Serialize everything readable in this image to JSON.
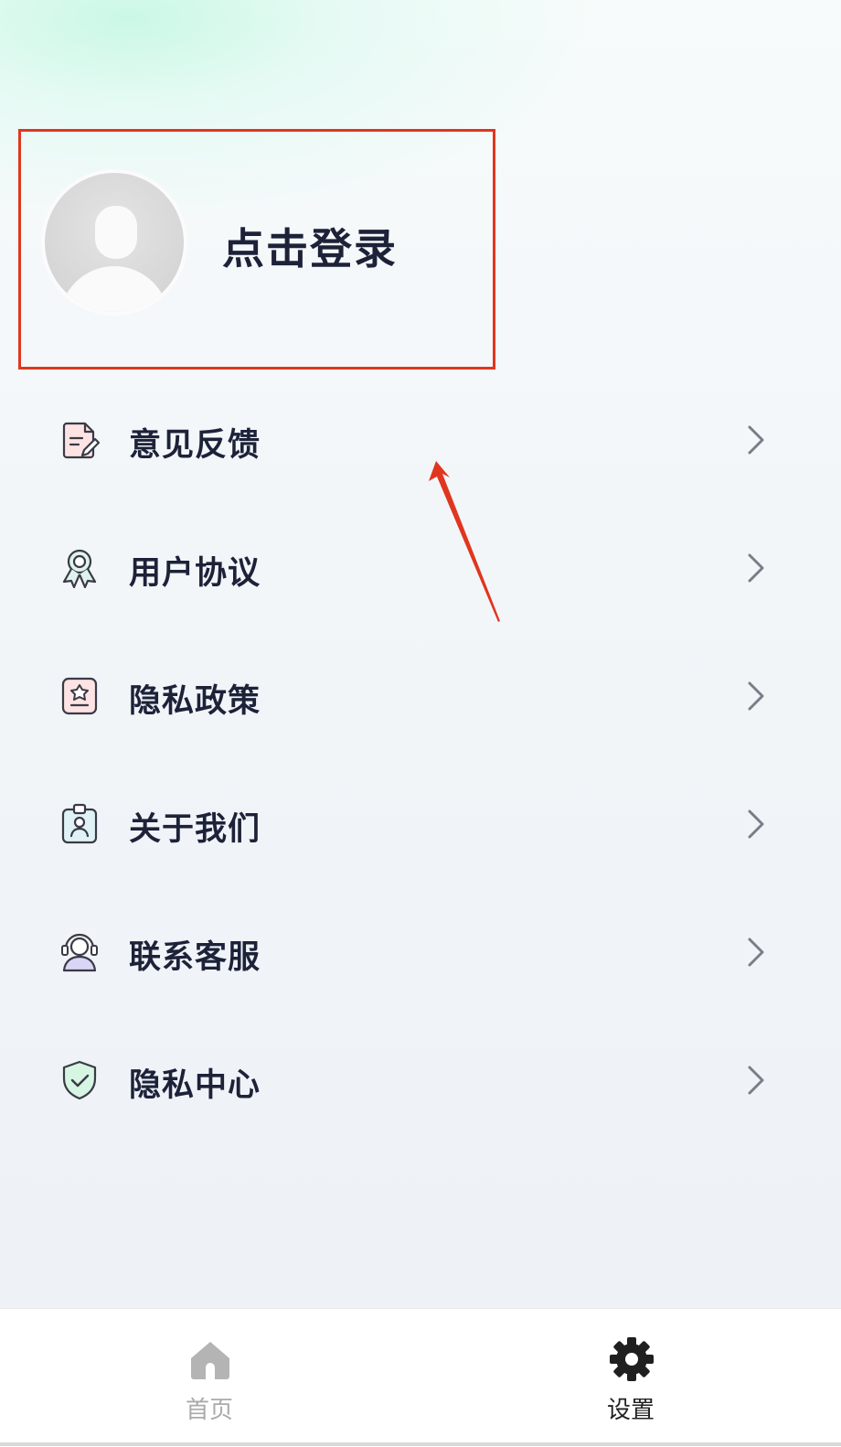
{
  "profile": {
    "login_label": "点击登录",
    "avatar_icon": "user-avatar-placeholder"
  },
  "menu": [
    {
      "label": "意见反馈",
      "icon": "feedback-icon"
    },
    {
      "label": "用户协议",
      "icon": "award-icon"
    },
    {
      "label": "隐私政策",
      "icon": "policy-icon"
    },
    {
      "label": "关于我们",
      "icon": "badge-icon"
    },
    {
      "label": "联系客服",
      "icon": "customer-service-icon"
    },
    {
      "label": "隐私中心",
      "icon": "shield-check-icon"
    }
  ],
  "tabbar": {
    "home_label": "首页",
    "settings_label": "设置",
    "active": "settings"
  },
  "colors": {
    "annotation": "#e0361f",
    "text": "#1d2239",
    "tab_inactive": "#aaaaaa",
    "tab_active": "#222222"
  }
}
